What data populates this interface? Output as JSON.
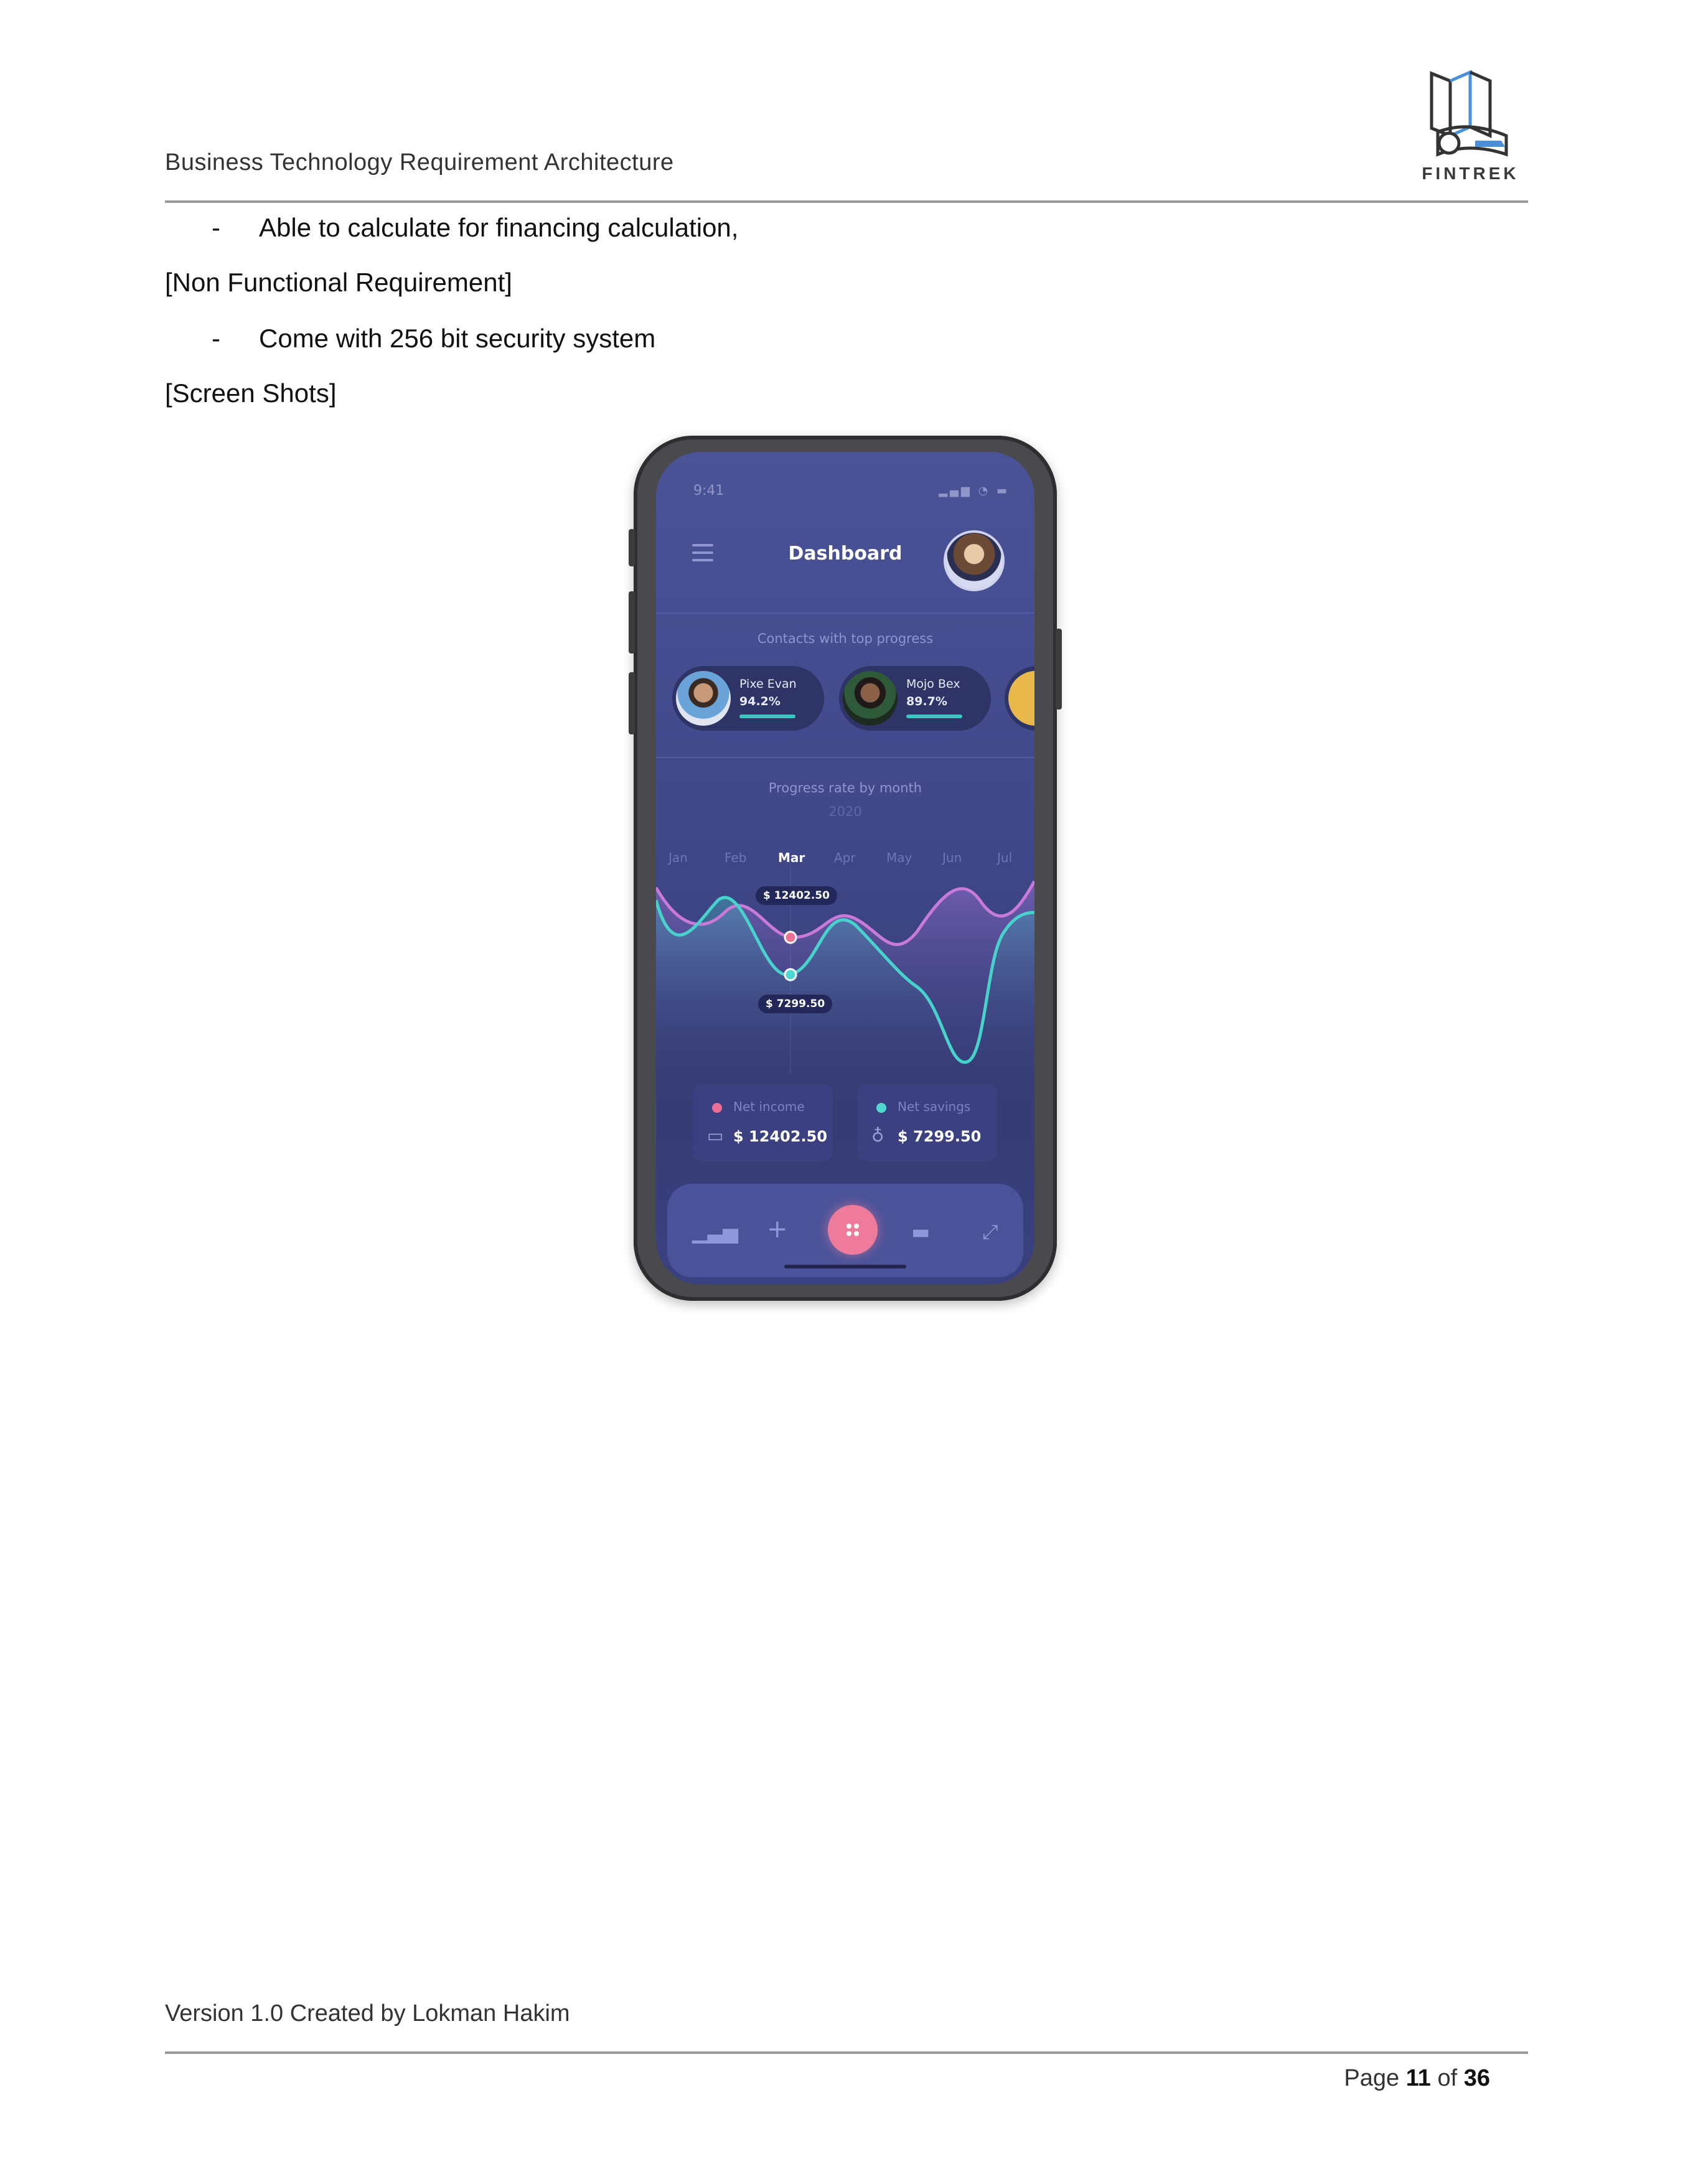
{
  "header": {
    "title": "Business Technology Requirement Architecture",
    "logo": {
      "text": "FINTREK",
      "icon": "fintrek-logo-icon"
    }
  },
  "content": {
    "bullet_1": "Able to calculate for financing calculation,",
    "section_nonfunctional": "[Non Functional Requirement]",
    "bullet_2": "Come with 256 bit security system",
    "section_screenshots": "[Screen Shots]",
    "dash_char": "-"
  },
  "app": {
    "status_time": "9:41",
    "title": "Dashboard",
    "contacts_heading": "Contacts with top progress",
    "contacts": [
      {
        "name": "Pixe Evan",
        "percent": "94.2%"
      },
      {
        "name": "Mojo Bex",
        "percent": "89.7%"
      }
    ],
    "chart_heading": "Progress rate by month",
    "chart_year": "2020",
    "months": [
      "Jan",
      "Feb",
      "Mar",
      "Apr",
      "May",
      "Jun",
      "Jul"
    ],
    "active_month": "Mar",
    "income_badge": "$ 12402.50",
    "savings_badge": "$ 7299.50",
    "stats": [
      {
        "label": "Net income",
        "value": "$ 12402.50",
        "dot_color": "#ec6f96",
        "icon": "wallet-icon"
      },
      {
        "label": "Net savings",
        "value": "$ 7299.50",
        "dot_color": "#4fd7cf",
        "icon": "piggy-bank-icon"
      }
    ],
    "nav_icons": [
      "bar-chart-icon",
      "plus-icon",
      "grid-icon",
      "card-icon",
      "expand-icon"
    ],
    "colors": {
      "income_line": "#c77ad8",
      "savings_line": "#48d2cc",
      "accent": "#ee7a9c"
    }
  },
  "footer": {
    "text": "Version 1.0 Created by Lokman Hakim",
    "page_prefix": "Page",
    "page_current": "11",
    "page_of": "of",
    "page_total": "36"
  }
}
